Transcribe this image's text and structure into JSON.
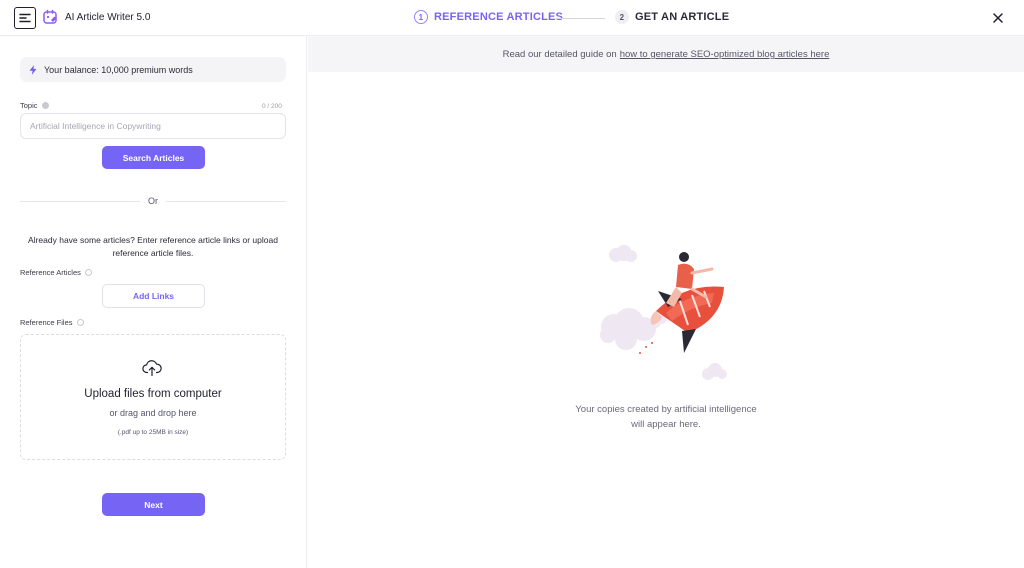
{
  "header": {
    "app_title": "AI Article Writer 5.0",
    "steps": [
      {
        "number": "1",
        "label": "REFERENCE ARTICLES",
        "active": true
      },
      {
        "number": "2",
        "label": "GET AN ARTICLE",
        "active": false
      }
    ],
    "icons": {
      "menu": "menu-icon",
      "logo": "ai-writer-logo-icon",
      "close": "close-icon"
    }
  },
  "left": {
    "balance_text": "Your balance: 10,000 premium words",
    "topic": {
      "label": "Topic",
      "counter": "0 / 200",
      "value": "",
      "placeholder": "Artificial Intelligence in Copywriting"
    },
    "search_button": "Search Articles",
    "or_text": "Or",
    "already_text": "Already have some articles? Enter reference article links or upload reference article files.",
    "reference_articles_label": "Reference Articles",
    "add_links_button": "Add Links",
    "reference_files_label": "Reference Files",
    "upload": {
      "title": "Upload files from computer",
      "subtitle": "or drag and drop here",
      "limit": "(.pdf up to 25MB in size)"
    },
    "next_button": "Next"
  },
  "right": {
    "guide_prefix": "Read our detailed guide on",
    "guide_link": "how to generate SEO-optimized blog articles here",
    "empty_line1": "Your copies created by artificial intelligence",
    "empty_line2": "will appear here."
  },
  "colors": {
    "accent": "#7664f5",
    "step_active": "#7b62f4",
    "guide_bar_bg": "#f5f5f7",
    "balance_bg": "#f4f4f6"
  }
}
